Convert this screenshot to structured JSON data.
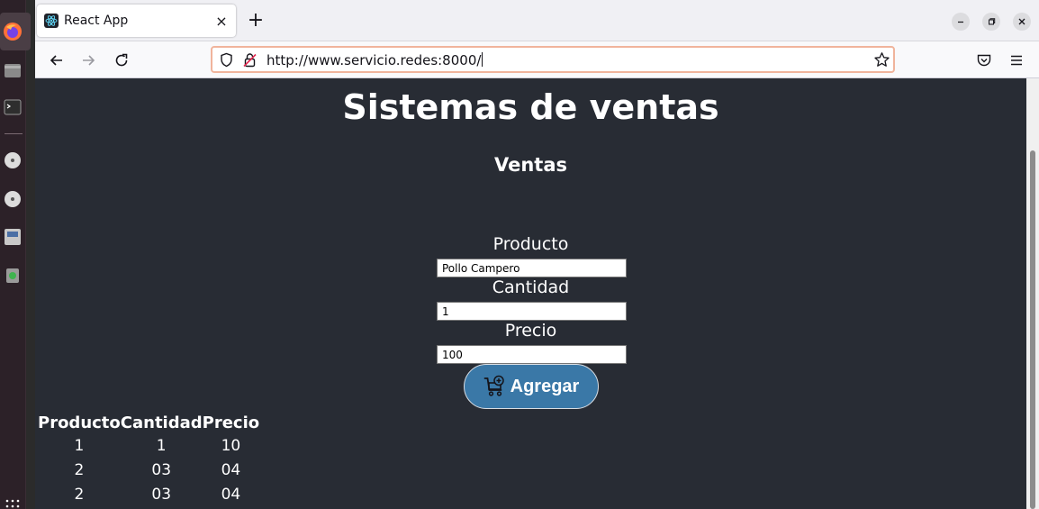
{
  "browser": {
    "tab_title": "React App",
    "tab_close": "×",
    "new_tab": "+",
    "url": "http://www.servicio.redes:8000/"
  },
  "page": {
    "title": "Sistemas de ventas",
    "section": "Ventas",
    "form": {
      "producto_label": "Producto",
      "producto_value": "Pollo Campero",
      "cantidad_label": "Cantidad",
      "cantidad_value": "1",
      "precio_label": "Precio",
      "precio_value": "100",
      "add_button_label": "Agregar"
    },
    "table": {
      "headers": [
        "Producto",
        "Cantidad",
        "Precio"
      ],
      "rows": [
        [
          "1",
          "1",
          "10"
        ],
        [
          "2",
          "03",
          "04"
        ],
        [
          "2",
          "03",
          "04"
        ]
      ]
    }
  },
  "colors": {
    "page_background": "#282c34",
    "button_background": "#3a78a7",
    "urlbar_focus_border": "#f0b49c"
  },
  "icons": {
    "dock": [
      "firefox-icon",
      "files-icon",
      "terminal-icon",
      "disc-icon",
      "disc-icon",
      "save-icon",
      "trash-icon",
      "app-grid-icon"
    ],
    "toolbar": [
      "back-icon",
      "forward-icon",
      "reload-icon",
      "shield-icon",
      "insecure-lock-icon",
      "star-icon",
      "pocket-icon",
      "menu-icon"
    ],
    "button": "cart-add-icon"
  }
}
